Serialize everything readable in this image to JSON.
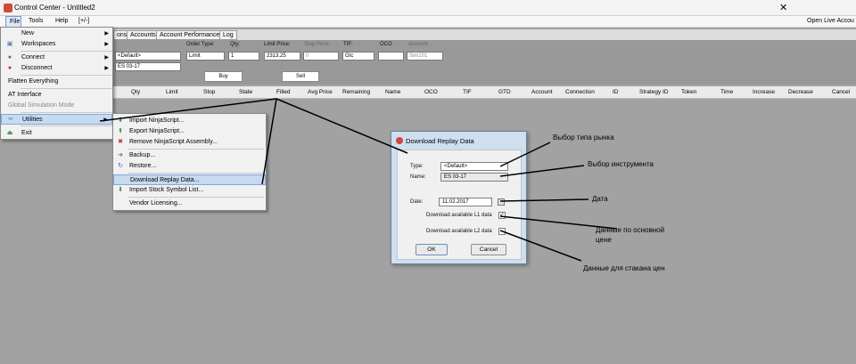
{
  "window": {
    "title": "Control Center - Untitled2",
    "right_text": "Open Live Accou"
  },
  "menubar": [
    "File",
    "Tools",
    "Help",
    "[+/-]"
  ],
  "tabs": [
    "ons",
    "Accounts",
    "Account Performance",
    "Log"
  ],
  "toolbar": {
    "order_type_label": "Order Type:",
    "qty_label": "Qty:",
    "limit_price_label": "Limit Price:",
    "stop_price_label": "Stop Price",
    "tif_label": "TIF:",
    "oco_label": "OCO",
    "account_label": "Account",
    "type_value": "<Default>",
    "instrument_value": "ES 03-17",
    "order_type_value": "Limit",
    "qty_value": "1",
    "limit_price_value": "2313.25",
    "stop_price_value": "0",
    "tif_value": "Gtc",
    "oco_value": "",
    "account_value": "Sim101",
    "buy": "Buy",
    "sell": "Sell"
  },
  "grid_columns": [
    "Qty",
    "Limit",
    "Stop",
    "State",
    "Filled",
    "Avg Price",
    "Remaining",
    "Name",
    "OCO",
    "TIF",
    "GTD",
    "Account",
    "Connection",
    "ID",
    "Strategy ID",
    "Token",
    "Time",
    "Increase",
    "Decrease",
    "Cancel"
  ],
  "file_menu": {
    "new": "New",
    "workspaces": "Workspaces",
    "connect": "Connect",
    "disconnect": "Disconnect",
    "flatten": "Flatten Everything",
    "at_interface": "AT Interface",
    "global_sim": "Global Simulation Mode",
    "utilities": "Utilities",
    "exit": "Exit"
  },
  "utilities_menu": {
    "import_ninjascript": "Import NinjaScript...",
    "export_ninjascript": "Export NinjaScript...",
    "remove_assembly": "Remove NinjaScript Assembly...",
    "backup": "Backup...",
    "restore": "Restore...",
    "download_replay": "Download Replay Data...",
    "import_stock": "Import Stock Symbol List...",
    "vendor_licensing": "Vendor Licensing..."
  },
  "dialog": {
    "title": "Download Replay Data",
    "type_label": "Type:",
    "type_value": "<Default>",
    "name_label": "Name:",
    "name_value": "ES 03-17",
    "date_label": "Date:",
    "date_value": "11.02.2017",
    "l1_label": "Download available L1 data",
    "l1_checked": true,
    "l2_label": "Download available L2 data",
    "l2_checked": false,
    "ok": "OK",
    "cancel": "Cancel"
  },
  "annotations": {
    "market_type": "Выбор типа рынка",
    "instrument": "Выбор инструмента",
    "date": "Дата",
    "l1_line1": "Данные по основной",
    "l1_line2": "цене",
    "l2": "Данные для стакана цен"
  },
  "colors": {
    "workspace_bg": "#a2a2a2",
    "menu_highlight": "#c6daf1",
    "dialog_frame": "#cfdff0"
  }
}
